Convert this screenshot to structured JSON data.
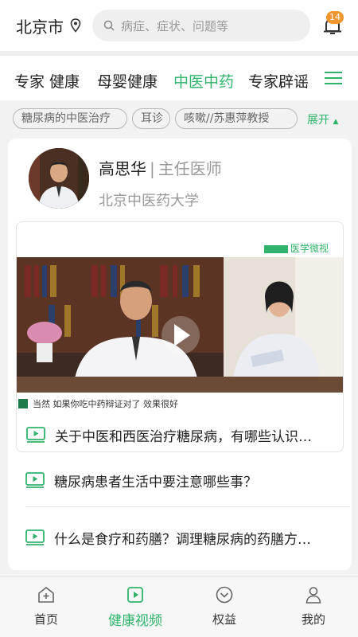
{
  "header": {
    "city": "北京市",
    "search_placeholder": "病症、症状、问题等",
    "notification_count": "14"
  },
  "tabs": [
    "专家 健康",
    "母婴健康",
    "中医中药",
    "专家辟谣"
  ],
  "active_tab": "中医中药",
  "tags": [
    "糖尿病的中医治疗",
    "耳诊",
    "咳嗽//苏惠萍教授"
  ],
  "expand_label": "展开",
  "doctor": {
    "name": "高思华",
    "separator": "|",
    "title": "主任医师",
    "organization": "北京中医药大学"
  },
  "video": {
    "logo": "医学微视",
    "subtitle": "当然 如果你吃中药辩证对了 效果很好"
  },
  "items": [
    "关于中医和西医治疗糖尿病，有哪些认识…",
    "糖尿病患者生活中要注意哪些事？",
    "什么是食疗和药膳？调理糖尿病的药膳方…"
  ],
  "bottom_nav": [
    "首页",
    "健康视频",
    "权益",
    "我的"
  ],
  "colors": {
    "accent": "#2fb36a",
    "badge": "#f0962f"
  }
}
